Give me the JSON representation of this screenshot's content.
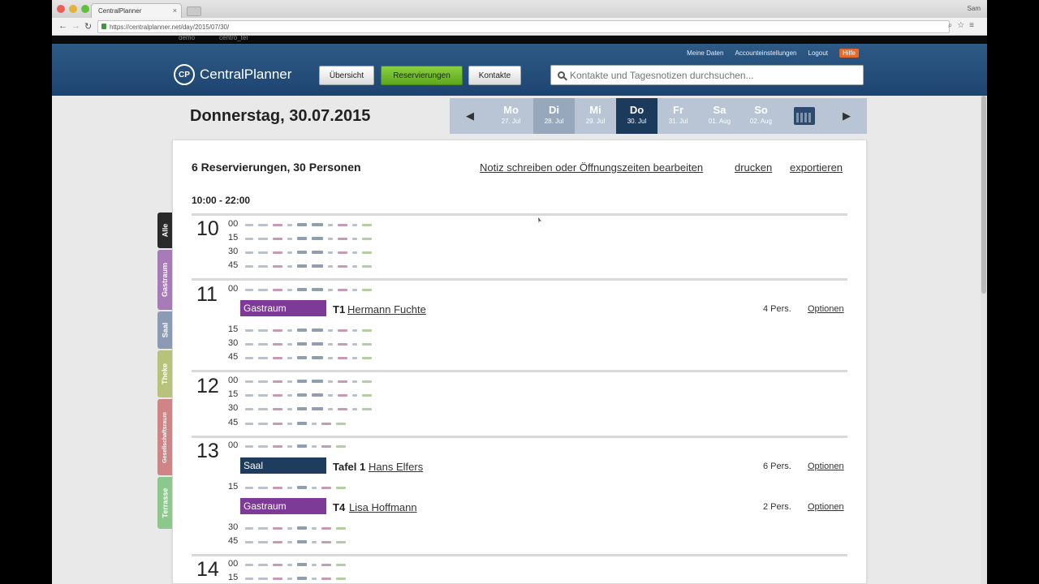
{
  "browser": {
    "tab_title": "CentralPlanner",
    "url": "https://centralplanner.net/day/2015/07/30/",
    "user": "Sam"
  },
  "strip": {
    "left": "demo",
    "right": "centro_tel"
  },
  "header": {
    "top_links": [
      "Meine Daten",
      "Accounteinstellungen",
      "Logout"
    ],
    "help": "Hilfe",
    "logo": "CentralPlanner",
    "logo_mark": "CP",
    "nav": {
      "overview": "Übersicht",
      "reservations": "Reservierungen",
      "contacts": "Kontakte"
    },
    "search_placeholder": "Kontakte und Tagesnotizen durchsuchen..."
  },
  "day_title": "Donnerstag, 30.07.2015",
  "week": [
    {
      "day": "Mo",
      "date": "27. Jul"
    },
    {
      "day": "Di",
      "date": "28. Jul"
    },
    {
      "day": "Mi",
      "date": "29. Jul"
    },
    {
      "day": "Do",
      "date": "30. Jul"
    },
    {
      "day": "Fr",
      "date": "31. Jul"
    },
    {
      "day": "Sa",
      "date": "01. Aug"
    },
    {
      "day": "So",
      "date": "02. Aug"
    }
  ],
  "panel": {
    "summary": "6 Reservierungen, 30 Personen",
    "links": [
      "Notiz schreiben oder Öffnungszeiten bearbeiten",
      "drucken",
      "exportieren"
    ],
    "range": "10:00 - 22:00"
  },
  "side_tabs": [
    "Alle",
    "Gastraum",
    "Saal",
    "Theke",
    "Gesellschaftsraum",
    "Terrasse"
  ],
  "hours": [
    {
      "hour": "10",
      "minutes": [
        "00",
        "15",
        "30",
        "45"
      ]
    },
    {
      "hour": "11",
      "minutes": [
        "00",
        "15",
        "30",
        "45"
      ]
    },
    {
      "hour": "12",
      "minutes": [
        "00",
        "15",
        "30",
        "45"
      ]
    },
    {
      "hour": "13",
      "minutes": [
        "00",
        "15",
        "30",
        "45"
      ]
    },
    {
      "hour": "14",
      "minutes": [
        "00",
        "15"
      ]
    }
  ],
  "reservations": [
    {
      "room": "Gastraum",
      "table": "T1",
      "guest": "Hermann Fuchte",
      "persons": "4 Pers.",
      "options": "Optionen"
    },
    {
      "room": "Saal",
      "table": "Tafel 1",
      "guest": "Hans Elfers",
      "persons": "6 Pers.",
      "options": "Optionen"
    },
    {
      "room": "Gastraum",
      "table": "T4",
      "guest": "Lisa Hoffmann",
      "persons": "2 Pers.",
      "options": "Optionen"
    }
  ],
  "colors": {
    "header": "#1d4470",
    "active_nav": "#6cb52a",
    "gastraum": "#7d3a96",
    "saal": "#1e3c5e",
    "tab_alle": "#2a2a2a",
    "tab_gastraum": "#a67bb8",
    "tab_saal": "#8a9bb3",
    "tab_theke": "#b7c27a",
    "tab_gesellschaft": "#cf8585",
    "tab_terrasse": "#8cc88c"
  }
}
